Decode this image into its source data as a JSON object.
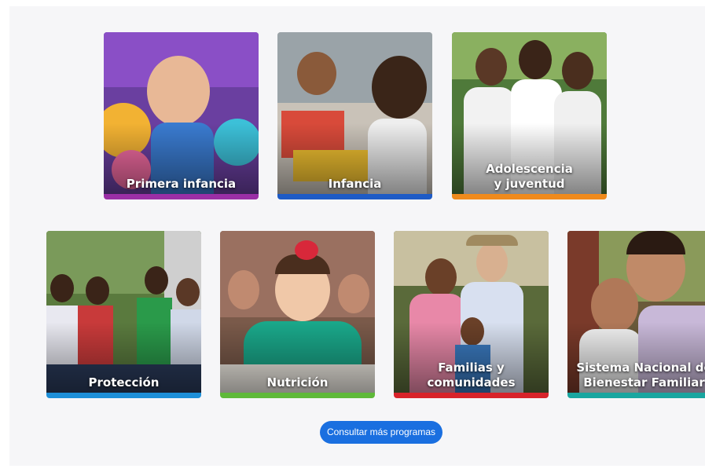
{
  "cards": [
    {
      "label": "Primera infancia",
      "bar_color": "#9b2fa6"
    },
    {
      "label": "Infancia",
      "bar_color": "#1e5bc6"
    },
    {
      "label": "Adolescencia\ny juventud",
      "bar_color": "#f08a1c"
    },
    {
      "label": "Protección",
      "bar_color": "#1e8fd8"
    },
    {
      "label": "Nutrición",
      "bar_color": "#5fb93a"
    },
    {
      "label": "Familias y comunidades",
      "bar_color": "#d8232a"
    },
    {
      "label": "Sistema Nacional de\nBienestar Familiar",
      "bar_color": "#19a6a0"
    }
  ],
  "cta": {
    "label": "Consultar más programas",
    "color": "#1a6fe0"
  }
}
